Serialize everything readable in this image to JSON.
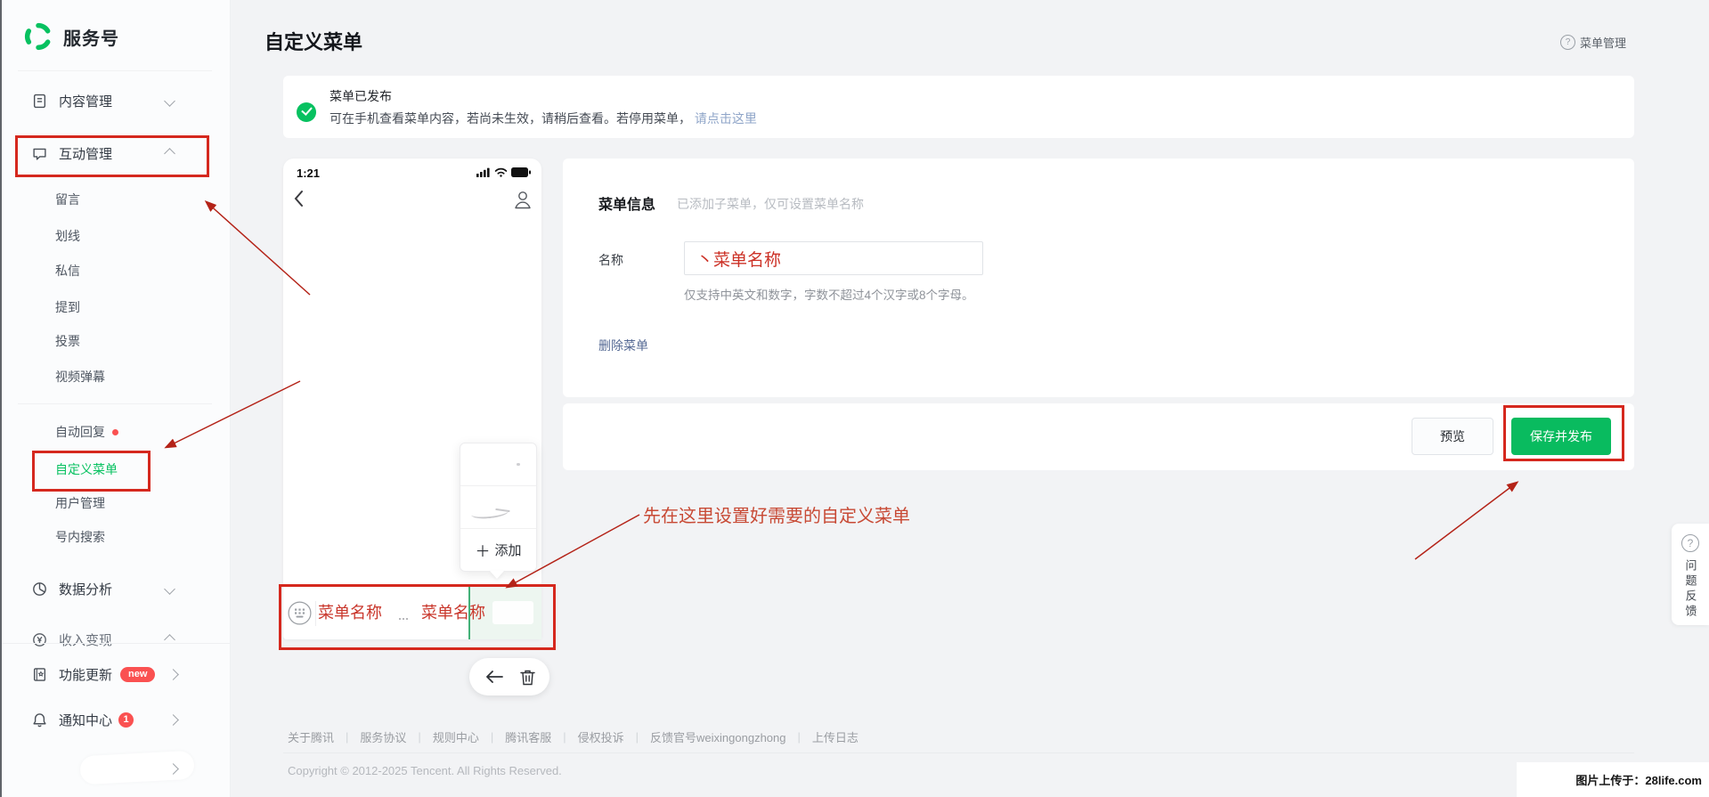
{
  "sidebar": {
    "brand": "服务号",
    "content_mgmt": "内容管理",
    "interact_mgmt": "互动管理",
    "sub_items": [
      "留言",
      "划线",
      "私信",
      "提到",
      "投票",
      "视频弹幕"
    ],
    "auto_reply": "自动回复",
    "custom_menu": "自定义菜单",
    "user_mgmt": "用户管理",
    "account_search": "号内搜索",
    "data_analysis": "数据分析",
    "monetization": "收入变现",
    "feature_update": "功能更新",
    "feature_badge": "new",
    "notify_center": "通知中心",
    "notify_badge": "1"
  },
  "header": {
    "title": "自定义菜单",
    "help_glyph": "?",
    "help_label": "菜单管理"
  },
  "banner": {
    "title": "菜单已发布",
    "body": "可在手机查看菜单内容，若尚未生效，请稍后查看。若停用菜单，",
    "link_label": "请点击这里"
  },
  "phone": {
    "status_time": "1:21",
    "popup_plus": "＋",
    "popup_add_label": "添加",
    "menu_item_1": "菜单名称",
    "menu_item_2": "菜单名称"
  },
  "form": {
    "section_title": "菜单信息",
    "section_note": "已添加子菜单，仅可设置菜单名称",
    "name_label": "名称",
    "name_value": "丶菜单名称",
    "name_hint": "仅支持中英文和数字，字数不超过4个汉字或8个字母。",
    "delete_label": "删除菜单",
    "preview_label": "预览",
    "save_label": "保存并发布"
  },
  "annotation": {
    "tip": "先在这里设置好需要的自定义菜单"
  },
  "feedback": {
    "glyph": "?",
    "label": "问题反馈"
  },
  "footer": {
    "links": [
      "关于腾讯",
      "服务协议",
      "规则中心",
      "腾讯客服",
      "侵权投诉",
      "反馈官号weixingongzhong",
      "上传日志"
    ],
    "separator": "|",
    "copyright": "Copyright © 2012-2025 Tencent. All Rights Reserved."
  },
  "watermark": {
    "text": "图片上传于：28life.com"
  },
  "colors": {
    "brand_green": "#07c160",
    "annotation_red": "#d5281e",
    "badge_red": "#fa5151",
    "link_blue": "#576b95",
    "selected_slot_green": "#edf6f0"
  },
  "icons": [
    "wechat-brand-logo",
    "document-icon",
    "chat-icon",
    "pie-chart-icon",
    "coin-icon",
    "book-icon",
    "bell-icon",
    "question-circle-icon",
    "check-circle-icon",
    "signal-icon",
    "wifi-icon",
    "battery-icon",
    "back-chevron-icon",
    "person-icon",
    "keyboard-icon",
    "plus-icon",
    "back-arrow-icon",
    "trash-icon"
  ]
}
